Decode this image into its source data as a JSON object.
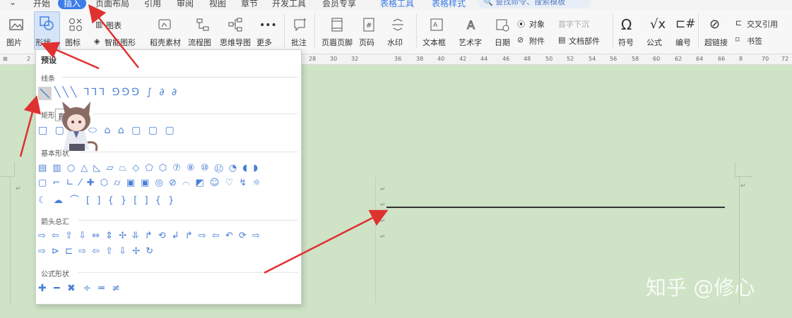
{
  "menu": {
    "items": [
      "开始",
      "插入",
      "页面布局",
      "引用",
      "审阅",
      "视图",
      "章节",
      "开发工具",
      "会员专享",
      "表格工具",
      "表格样式"
    ],
    "search_placeholder": "查找命令、搜索模板"
  },
  "ribbon": {
    "picture": "图片",
    "shape": "形状",
    "icon": "图标",
    "chart": "图表",
    "smart_art": "智能图形",
    "stock": "稻壳素材",
    "flowchart": "流程图",
    "mindmap": "思维导图",
    "more": "更多",
    "comment": "批注",
    "header_footer": "页眉页脚",
    "page_number": "页码",
    "watermark": "水印",
    "textbox": "文本框",
    "wordart": "艺术字",
    "date": "日期",
    "object": "对象",
    "dropcap": "首字下沉",
    "attachment": "附件",
    "doc_part": "文档部件",
    "symbol": "符号",
    "formula": "公式",
    "numbering": "编号",
    "hyperlink": "超链接",
    "crossref": "交叉引用",
    "bookmark": "书签"
  },
  "ruler": {
    "ticks": [
      "2",
      "28",
      "30",
      "32",
      "36",
      "38",
      "40",
      "42",
      "44",
      "46",
      "48",
      "50",
      "52",
      "54",
      "56",
      "58",
      "60",
      "62",
      "64",
      "66",
      "8",
      "70",
      "72"
    ]
  },
  "dropdown": {
    "title": "预设",
    "sections": [
      "线条",
      "矩形",
      "基本形状",
      "箭头总汇",
      "公式形状"
    ],
    "tooltip": "直线",
    "line_shapes": "╲╲╲ ⅂⅂⅂ ⅁⅁⅁ ∫ ∂ ∂",
    "rect_shapes": "□ ▢ ▭ ⬭ ⌂ ⌂ ▢ ▢ ▢",
    "basic_row1": "▤ ▥ ○ △ ◺ ▱ ⏢ ◇ ⬠ ⬡ ⑦ ⑧ ⑩ ⑫ ◔ ◖ ◗",
    "basic_row2": "▢ ⌐ ∟ ⁄ ✚ ⬡ ⌭ ▣ ▣ ◎ ⊘ ⌒ ◩ ☺ ♡ ↯ ☼",
    "basic_row3": "☾ ☁ ⌒ [ ] { } [ ] { }",
    "arrow_row1": "⇨ ⇦ ⇧ ⇩ ⇔ ⇕ ✢ ⥥ ↱ ⟲ ↲ ↱ ⇨ ⇦ ↶ ⟳ ⇨",
    "arrow_row2": "⇨ ⊳ ⊏ ⇨ ⇦ ⇧ ⇩ ✢ ↻",
    "formula_row": "✚ ━ ✖ ÷ ═ ≠"
  },
  "watermark_text": "知乎 @修心"
}
